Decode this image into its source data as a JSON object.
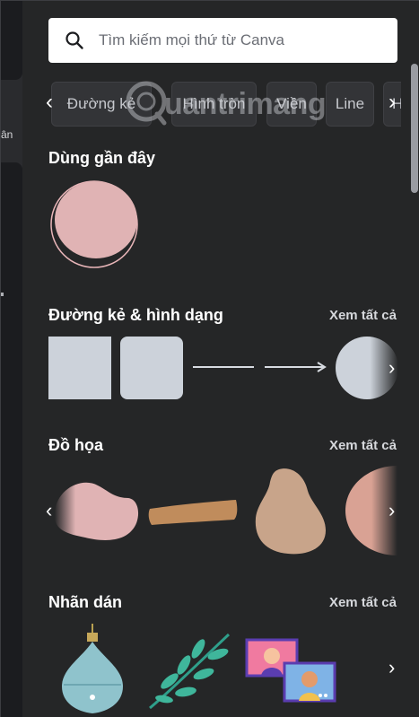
{
  "rail": {
    "partial_label": "ân"
  },
  "search": {
    "placeholder": "Tìm kiếm mọi thứ từ Canva"
  },
  "chips": [
    "Đường kẻ",
    "Hình tròn",
    "Viền",
    "Line",
    "Hì"
  ],
  "watermark": {
    "text": "uantrimang"
  },
  "sections": {
    "recent": {
      "title": "Dùng gần đây"
    },
    "lines": {
      "title": "Đường kẻ & hình dạng",
      "see_all": "Xem tất cả"
    },
    "graphics": {
      "title": "Đồ họa",
      "see_all": "Xem tất cả"
    },
    "stickers": {
      "title": "Nhãn dán",
      "see_all": "Xem tất cả"
    }
  },
  "colors": {
    "panel_bg": "#252627",
    "shape_gray": "#ccd2da",
    "shape_pink": "#e0b3b4",
    "accent_pink": "#f0c0c6"
  },
  "icons": [
    "search-icon",
    "chevron-left-icon",
    "chevron-right-icon",
    "arrow-right-icon"
  ]
}
